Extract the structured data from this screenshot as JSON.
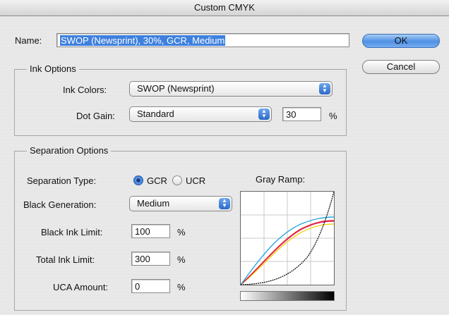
{
  "window": {
    "title": "Custom CMYK"
  },
  "name_row": {
    "label": "Name:",
    "value": "SWOP (Newsprint), 30%, GCR, Medium"
  },
  "buttons": {
    "ok": "OK",
    "cancel": "Cancel"
  },
  "ink_options": {
    "legend": "Ink Options",
    "ink_colors_label": "Ink Colors:",
    "ink_colors_value": "SWOP (Newsprint)",
    "dot_gain_label": "Dot Gain:",
    "dot_gain_value": "Standard",
    "dot_gain_percent": "30",
    "percent": "%"
  },
  "separation_options": {
    "legend": "Separation Options",
    "separation_type_label": "Separation Type:",
    "gcr_label": "GCR",
    "ucr_label": "UCR",
    "selected_type": "GCR",
    "black_generation_label": "Black Generation:",
    "black_generation_value": "Medium",
    "black_ink_limit_label": "Black Ink Limit:",
    "black_ink_limit_value": "100",
    "total_ink_limit_label": "Total Ink Limit:",
    "total_ink_limit_value": "300",
    "uca_amount_label": "UCA Amount:",
    "uca_amount_value": "0",
    "percent": "%"
  },
  "gray_ramp": {
    "title": "Gray Ramp:",
    "colors": {
      "cyan": "#2aa7e0",
      "magenta": "#e83a8c",
      "yellow": "#f2d21a",
      "black": "#000000"
    }
  },
  "colors": {
    "accent": "#3d80df",
    "selection": "#3d80df"
  }
}
